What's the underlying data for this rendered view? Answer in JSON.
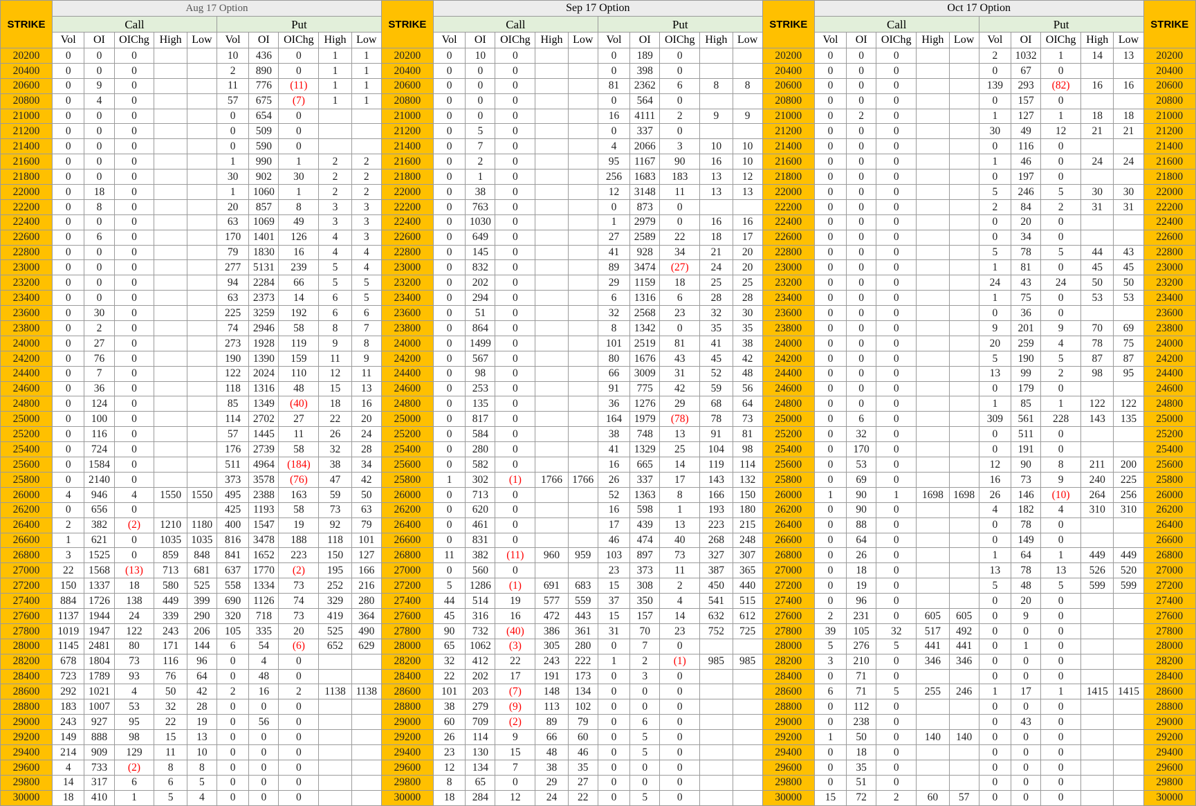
{
  "strike_label": "STRIKE",
  "months": [
    "Aug 17 Option",
    "Sep 17 Option",
    "Oct 17 Option"
  ],
  "group_labels": [
    "Call",
    "Put"
  ],
  "columns": [
    "Vol",
    "OI",
    "OIChg",
    "High",
    "Low"
  ],
  "colors": {
    "strike_bg": "#ffc000",
    "month_bg": "#ececec",
    "group_bg": "#e2efda",
    "negative": "#ff0000"
  },
  "rows": [
    [
      "20200",
      "0",
      "0",
      "0",
      "",
      "",
      "10",
      "436",
      "0",
      "1",
      "1",
      "0",
      "10",
      "0",
      "",
      "",
      "0",
      "189",
      "0",
      "",
      "",
      "0",
      "0",
      "0",
      "",
      "",
      "2",
      "1032",
      "1",
      "14",
      "13"
    ],
    [
      "20400",
      "0",
      "0",
      "0",
      "",
      "",
      "2",
      "890",
      "0",
      "1",
      "1",
      "0",
      "0",
      "0",
      "",
      "",
      "0",
      "398",
      "0",
      "",
      "",
      "0",
      "0",
      "0",
      "",
      "",
      "0",
      "67",
      "0",
      "",
      ""
    ],
    [
      "20600",
      "0",
      "9",
      "0",
      "",
      "",
      "11",
      "776",
      "(11)",
      "1",
      "1",
      "0",
      "0",
      "0",
      "",
      "",
      "81",
      "2362",
      "6",
      "8",
      "8",
      "0",
      "0",
      "0",
      "",
      "",
      "139",
      "293",
      "(82)",
      "16",
      "16"
    ],
    [
      "20800",
      "0",
      "4",
      "0",
      "",
      "",
      "57",
      "675",
      "(7)",
      "1",
      "1",
      "0",
      "0",
      "0",
      "",
      "",
      "0",
      "564",
      "0",
      "",
      "",
      "0",
      "0",
      "0",
      "",
      "",
      "0",
      "157",
      "0",
      "",
      ""
    ],
    [
      "21000",
      "0",
      "0",
      "0",
      "",
      "",
      "0",
      "654",
      "0",
      "",
      "",
      "0",
      "0",
      "0",
      "",
      "",
      "16",
      "4111",
      "2",
      "9",
      "9",
      "0",
      "2",
      "0",
      "",
      "",
      "1",
      "127",
      "1",
      "18",
      "18"
    ],
    [
      "21200",
      "0",
      "0",
      "0",
      "",
      "",
      "0",
      "509",
      "0",
      "",
      "",
      "0",
      "5",
      "0",
      "",
      "",
      "0",
      "337",
      "0",
      "",
      "",
      "0",
      "0",
      "0",
      "",
      "",
      "30",
      "49",
      "12",
      "21",
      "21"
    ],
    [
      "21400",
      "0",
      "0",
      "0",
      "",
      "",
      "0",
      "590",
      "0",
      "",
      "",
      "0",
      "7",
      "0",
      "",
      "",
      "4",
      "2066",
      "3",
      "10",
      "10",
      "0",
      "0",
      "0",
      "",
      "",
      "0",
      "116",
      "0",
      "",
      ""
    ],
    [
      "21600",
      "0",
      "0",
      "0",
      "",
      "",
      "1",
      "990",
      "1",
      "2",
      "2",
      "0",
      "2",
      "0",
      "",
      "",
      "95",
      "1167",
      "90",
      "16",
      "10",
      "0",
      "0",
      "0",
      "",
      "",
      "1",
      "46",
      "0",
      "24",
      "24"
    ],
    [
      "21800",
      "0",
      "0",
      "0",
      "",
      "",
      "30",
      "902",
      "30",
      "2",
      "2",
      "0",
      "1",
      "0",
      "",
      "",
      "256",
      "1683",
      "183",
      "13",
      "12",
      "0",
      "0",
      "0",
      "",
      "",
      "0",
      "197",
      "0",
      "",
      ""
    ],
    [
      "22000",
      "0",
      "18",
      "0",
      "",
      "",
      "1",
      "1060",
      "1",
      "2",
      "2",
      "0",
      "38",
      "0",
      "",
      "",
      "12",
      "3148",
      "11",
      "13",
      "13",
      "0",
      "0",
      "0",
      "",
      "",
      "5",
      "246",
      "5",
      "30",
      "30"
    ],
    [
      "22200",
      "0",
      "8",
      "0",
      "",
      "",
      "20",
      "857",
      "8",
      "3",
      "3",
      "0",
      "763",
      "0",
      "",
      "",
      "0",
      "873",
      "0",
      "",
      "",
      "0",
      "0",
      "0",
      "",
      "",
      "2",
      "84",
      "2",
      "31",
      "31"
    ],
    [
      "22400",
      "0",
      "0",
      "0",
      "",
      "",
      "63",
      "1069",
      "49",
      "3",
      "3",
      "0",
      "1030",
      "0",
      "",
      "",
      "1",
      "2979",
      "0",
      "16",
      "16",
      "0",
      "0",
      "0",
      "",
      "",
      "0",
      "20",
      "0",
      "",
      ""
    ],
    [
      "22600",
      "0",
      "6",
      "0",
      "",
      "",
      "170",
      "1401",
      "126",
      "4",
      "3",
      "0",
      "649",
      "0",
      "",
      "",
      "27",
      "2589",
      "22",
      "18",
      "17",
      "0",
      "0",
      "0",
      "",
      "",
      "0",
      "34",
      "0",
      "",
      ""
    ],
    [
      "22800",
      "0",
      "0",
      "0",
      "",
      "",
      "79",
      "1830",
      "16",
      "4",
      "4",
      "0",
      "145",
      "0",
      "",
      "",
      "41",
      "928",
      "34",
      "21",
      "20",
      "0",
      "0",
      "0",
      "",
      "",
      "5",
      "78",
      "5",
      "44",
      "43"
    ],
    [
      "23000",
      "0",
      "0",
      "0",
      "",
      "",
      "277",
      "5131",
      "239",
      "5",
      "4",
      "0",
      "832",
      "0",
      "",
      "",
      "89",
      "3474",
      "(27)",
      "24",
      "20",
      "0",
      "0",
      "0",
      "",
      "",
      "1",
      "81",
      "0",
      "45",
      "45"
    ],
    [
      "23200",
      "0",
      "0",
      "0",
      "",
      "",
      "94",
      "2284",
      "66",
      "5",
      "5",
      "0",
      "202",
      "0",
      "",
      "",
      "29",
      "1159",
      "18",
      "25",
      "25",
      "0",
      "0",
      "0",
      "",
      "",
      "24",
      "43",
      "24",
      "50",
      "50"
    ],
    [
      "23400",
      "0",
      "0",
      "0",
      "",
      "",
      "63",
      "2373",
      "14",
      "6",
      "5",
      "0",
      "294",
      "0",
      "",
      "",
      "6",
      "1316",
      "6",
      "28",
      "28",
      "0",
      "0",
      "0",
      "",
      "",
      "1",
      "75",
      "0",
      "53",
      "53"
    ],
    [
      "23600",
      "0",
      "30",
      "0",
      "",
      "",
      "225",
      "3259",
      "192",
      "6",
      "6",
      "0",
      "51",
      "0",
      "",
      "",
      "32",
      "2568",
      "23",
      "32",
      "30",
      "0",
      "0",
      "0",
      "",
      "",
      "0",
      "36",
      "0",
      "",
      ""
    ],
    [
      "23800",
      "0",
      "2",
      "0",
      "",
      "",
      "74",
      "2946",
      "58",
      "8",
      "7",
      "0",
      "864",
      "0",
      "",
      "",
      "8",
      "1342",
      "0",
      "35",
      "35",
      "0",
      "0",
      "0",
      "",
      "",
      "9",
      "201",
      "9",
      "70",
      "69"
    ],
    [
      "24000",
      "0",
      "27",
      "0",
      "",
      "",
      "273",
      "1928",
      "119",
      "9",
      "8",
      "0",
      "1499",
      "0",
      "",
      "",
      "101",
      "2519",
      "81",
      "41",
      "38",
      "0",
      "0",
      "0",
      "",
      "",
      "20",
      "259",
      "4",
      "78",
      "75"
    ],
    [
      "24200",
      "0",
      "76",
      "0",
      "",
      "",
      "190",
      "1390",
      "159",
      "11",
      "9",
      "0",
      "567",
      "0",
      "",
      "",
      "80",
      "1676",
      "43",
      "45",
      "42",
      "0",
      "0",
      "0",
      "",
      "",
      "5",
      "190",
      "5",
      "87",
      "87"
    ],
    [
      "24400",
      "0",
      "7",
      "0",
      "",
      "",
      "122",
      "2024",
      "110",
      "12",
      "11",
      "0",
      "98",
      "0",
      "",
      "",
      "66",
      "3009",
      "31",
      "52",
      "48",
      "0",
      "0",
      "0",
      "",
      "",
      "13",
      "99",
      "2",
      "98",
      "95"
    ],
    [
      "24600",
      "0",
      "36",
      "0",
      "",
      "",
      "118",
      "1316",
      "48",
      "15",
      "13",
      "0",
      "253",
      "0",
      "",
      "",
      "91",
      "775",
      "42",
      "59",
      "56",
      "0",
      "0",
      "0",
      "",
      "",
      "0",
      "179",
      "0",
      "",
      ""
    ],
    [
      "24800",
      "0",
      "124",
      "0",
      "",
      "",
      "85",
      "1349",
      "(40)",
      "18",
      "16",
      "0",
      "135",
      "0",
      "",
      "",
      "36",
      "1276",
      "29",
      "68",
      "64",
      "0",
      "0",
      "0",
      "",
      "",
      "1",
      "85",
      "1",
      "122",
      "122"
    ],
    [
      "25000",
      "0",
      "100",
      "0",
      "",
      "",
      "114",
      "2702",
      "27",
      "22",
      "20",
      "0",
      "817",
      "0",
      "",
      "",
      "164",
      "1979",
      "(78)",
      "78",
      "73",
      "0",
      "6",
      "0",
      "",
      "",
      "309",
      "561",
      "228",
      "143",
      "135"
    ],
    [
      "25200",
      "0",
      "116",
      "0",
      "",
      "",
      "57",
      "1445",
      "11",
      "26",
      "24",
      "0",
      "584",
      "0",
      "",
      "",
      "38",
      "748",
      "13",
      "91",
      "81",
      "0",
      "32",
      "0",
      "",
      "",
      "0",
      "511",
      "0",
      "",
      ""
    ],
    [
      "25400",
      "0",
      "724",
      "0",
      "",
      "",
      "176",
      "2739",
      "58",
      "32",
      "28",
      "0",
      "280",
      "0",
      "",
      "",
      "41",
      "1329",
      "25",
      "104",
      "98",
      "0",
      "170",
      "0",
      "",
      "",
      "0",
      "191",
      "0",
      "",
      ""
    ],
    [
      "25600",
      "0",
      "1584",
      "0",
      "",
      "",
      "511",
      "4964",
      "(184)",
      "38",
      "34",
      "0",
      "582",
      "0",
      "",
      "",
      "16",
      "665",
      "14",
      "119",
      "114",
      "0",
      "53",
      "0",
      "",
      "",
      "12",
      "90",
      "8",
      "211",
      "200"
    ],
    [
      "25800",
      "0",
      "2140",
      "0",
      "",
      "",
      "373",
      "3578",
      "(76)",
      "47",
      "42",
      "1",
      "302",
      "(1)",
      "1766",
      "1766",
      "26",
      "337",
      "17",
      "143",
      "132",
      "0",
      "69",
      "0",
      "",
      "",
      "16",
      "73",
      "9",
      "240",
      "225"
    ],
    [
      "26000",
      "4",
      "946",
      "4",
      "1550",
      "1550",
      "495",
      "2388",
      "163",
      "59",
      "50",
      "0",
      "713",
      "0",
      "",
      "",
      "52",
      "1363",
      "8",
      "166",
      "150",
      "1",
      "90",
      "1",
      "1698",
      "1698",
      "26",
      "146",
      "(10)",
      "264",
      "256"
    ],
    [
      "26200",
      "0",
      "656",
      "0",
      "",
      "",
      "425",
      "1193",
      "58",
      "73",
      "63",
      "0",
      "620",
      "0",
      "",
      "",
      "16",
      "598",
      "1",
      "193",
      "180",
      "0",
      "90",
      "0",
      "",
      "",
      "4",
      "182",
      "4",
      "310",
      "310"
    ],
    [
      "26400",
      "2",
      "382",
      "(2)",
      "1210",
      "1180",
      "400",
      "1547",
      "19",
      "92",
      "79",
      "0",
      "461",
      "0",
      "",
      "",
      "17",
      "439",
      "13",
      "223",
      "215",
      "0",
      "88",
      "0",
      "",
      "",
      "0",
      "78",
      "0",
      "",
      ""
    ],
    [
      "26600",
      "1",
      "621",
      "0",
      "1035",
      "1035",
      "816",
      "3478",
      "188",
      "118",
      "101",
      "0",
      "831",
      "0",
      "",
      "",
      "46",
      "474",
      "40",
      "268",
      "248",
      "0",
      "64",
      "0",
      "",
      "",
      "0",
      "149",
      "0",
      "",
      ""
    ],
    [
      "26800",
      "3",
      "1525",
      "0",
      "859",
      "848",
      "841",
      "1652",
      "223",
      "150",
      "127",
      "11",
      "382",
      "(11)",
      "960",
      "959",
      "103",
      "897",
      "73",
      "327",
      "307",
      "0",
      "26",
      "0",
      "",
      "",
      "1",
      "64",
      "1",
      "449",
      "449"
    ],
    [
      "27000",
      "22",
      "1568",
      "(13)",
      "713",
      "681",
      "637",
      "1770",
      "(2)",
      "195",
      "166",
      "0",
      "560",
      "0",
      "",
      "",
      "23",
      "373",
      "11",
      "387",
      "365",
      "0",
      "18",
      "0",
      "",
      "",
      "13",
      "78",
      "13",
      "526",
      "520"
    ],
    [
      "27200",
      "150",
      "1337",
      "18",
      "580",
      "525",
      "558",
      "1334",
      "73",
      "252",
      "216",
      "5",
      "1286",
      "(1)",
      "691",
      "683",
      "15",
      "308",
      "2",
      "450",
      "440",
      "0",
      "19",
      "0",
      "",
      "",
      "5",
      "48",
      "5",
      "599",
      "599"
    ],
    [
      "27400",
      "884",
      "1726",
      "138",
      "449",
      "399",
      "690",
      "1126",
      "74",
      "329",
      "280",
      "44",
      "514",
      "19",
      "577",
      "559",
      "37",
      "350",
      "4",
      "541",
      "515",
      "0",
      "96",
      "0",
      "",
      "",
      "0",
      "20",
      "0",
      "",
      ""
    ],
    [
      "27600",
      "1137",
      "1944",
      "24",
      "339",
      "290",
      "320",
      "718",
      "73",
      "419",
      "364",
      "45",
      "316",
      "16",
      "472",
      "443",
      "15",
      "157",
      "14",
      "632",
      "612",
      "2",
      "231",
      "0",
      "605",
      "605",
      "0",
      "9",
      "0",
      "",
      ""
    ],
    [
      "27800",
      "1019",
      "1947",
      "122",
      "243",
      "206",
      "105",
      "335",
      "20",
      "525",
      "490",
      "90",
      "732",
      "(40)",
      "386",
      "361",
      "31",
      "70",
      "23",
      "752",
      "725",
      "39",
      "105",
      "32",
      "517",
      "492",
      "0",
      "0",
      "0",
      "",
      ""
    ],
    [
      "28000",
      "1145",
      "2481",
      "80",
      "171",
      "144",
      "6",
      "54",
      "(6)",
      "652",
      "629",
      "65",
      "1062",
      "(3)",
      "305",
      "280",
      "0",
      "7",
      "0",
      "",
      "",
      "5",
      "276",
      "5",
      "441",
      "441",
      "0",
      "1",
      "0",
      "",
      ""
    ],
    [
      "28200",
      "678",
      "1804",
      "73",
      "116",
      "96",
      "0",
      "4",
      "0",
      "",
      "",
      "32",
      "412",
      "22",
      "243",
      "222",
      "1",
      "2",
      "(1)",
      "985",
      "985",
      "3",
      "210",
      "0",
      "346",
      "346",
      "0",
      "0",
      "0",
      "",
      ""
    ],
    [
      "28400",
      "723",
      "1789",
      "93",
      "76",
      "64",
      "0",
      "48",
      "0",
      "",
      "",
      "22",
      "202",
      "17",
      "191",
      "173",
      "0",
      "3",
      "0",
      "",
      "",
      "0",
      "71",
      "0",
      "",
      "",
      "0",
      "0",
      "0",
      "",
      ""
    ],
    [
      "28600",
      "292",
      "1021",
      "4",
      "50",
      "42",
      "2",
      "16",
      "2",
      "1138",
      "1138",
      "101",
      "203",
      "(7)",
      "148",
      "134",
      "0",
      "0",
      "0",
      "",
      "",
      "6",
      "71",
      "5",
      "255",
      "246",
      "1",
      "17",
      "1",
      "1415",
      "1415"
    ],
    [
      "28800",
      "183",
      "1007",
      "53",
      "32",
      "28",
      "0",
      "0",
      "0",
      "",
      "",
      "38",
      "279",
      "(9)",
      "113",
      "102",
      "0",
      "0",
      "0",
      "",
      "",
      "0",
      "112",
      "0",
      "",
      "",
      "0",
      "0",
      "0",
      "",
      ""
    ],
    [
      "29000",
      "243",
      "927",
      "95",
      "22",
      "19",
      "0",
      "56",
      "0",
      "",
      "",
      "60",
      "709",
      "(2)",
      "89",
      "79",
      "0",
      "6",
      "0",
      "",
      "",
      "0",
      "238",
      "0",
      "",
      "",
      "0",
      "43",
      "0",
      "",
      ""
    ],
    [
      "29200",
      "149",
      "888",
      "98",
      "15",
      "13",
      "0",
      "0",
      "0",
      "",
      "",
      "26",
      "114",
      "9",
      "66",
      "60",
      "0",
      "5",
      "0",
      "",
      "",
      "1",
      "50",
      "0",
      "140",
      "140",
      "0",
      "0",
      "0",
      "",
      ""
    ],
    [
      "29400",
      "214",
      "909",
      "129",
      "11",
      "10",
      "0",
      "0",
      "0",
      "",
      "",
      "23",
      "130",
      "15",
      "48",
      "46",
      "0",
      "5",
      "0",
      "",
      "",
      "0",
      "18",
      "0",
      "",
      "",
      "0",
      "0",
      "0",
      "",
      ""
    ],
    [
      "29600",
      "4",
      "733",
      "(2)",
      "8",
      "8",
      "0",
      "0",
      "0",
      "",
      "",
      "12",
      "134",
      "7",
      "38",
      "35",
      "0",
      "0",
      "0",
      "",
      "",
      "0",
      "35",
      "0",
      "",
      "",
      "0",
      "0",
      "0",
      "",
      ""
    ],
    [
      "29800",
      "14",
      "317",
      "6",
      "6",
      "5",
      "0",
      "0",
      "0",
      "",
      "",
      "8",
      "65",
      "0",
      "29",
      "27",
      "0",
      "0",
      "0",
      "",
      "",
      "0",
      "51",
      "0",
      "",
      "",
      "0",
      "0",
      "0",
      "",
      ""
    ],
    [
      "30000",
      "18",
      "410",
      "1",
      "5",
      "4",
      "0",
      "0",
      "0",
      "",
      "",
      "18",
      "284",
      "12",
      "24",
      "22",
      "0",
      "5",
      "0",
      "",
      "",
      "15",
      "72",
      "2",
      "60",
      "57",
      "0",
      "0",
      "0",
      "",
      ""
    ]
  ]
}
